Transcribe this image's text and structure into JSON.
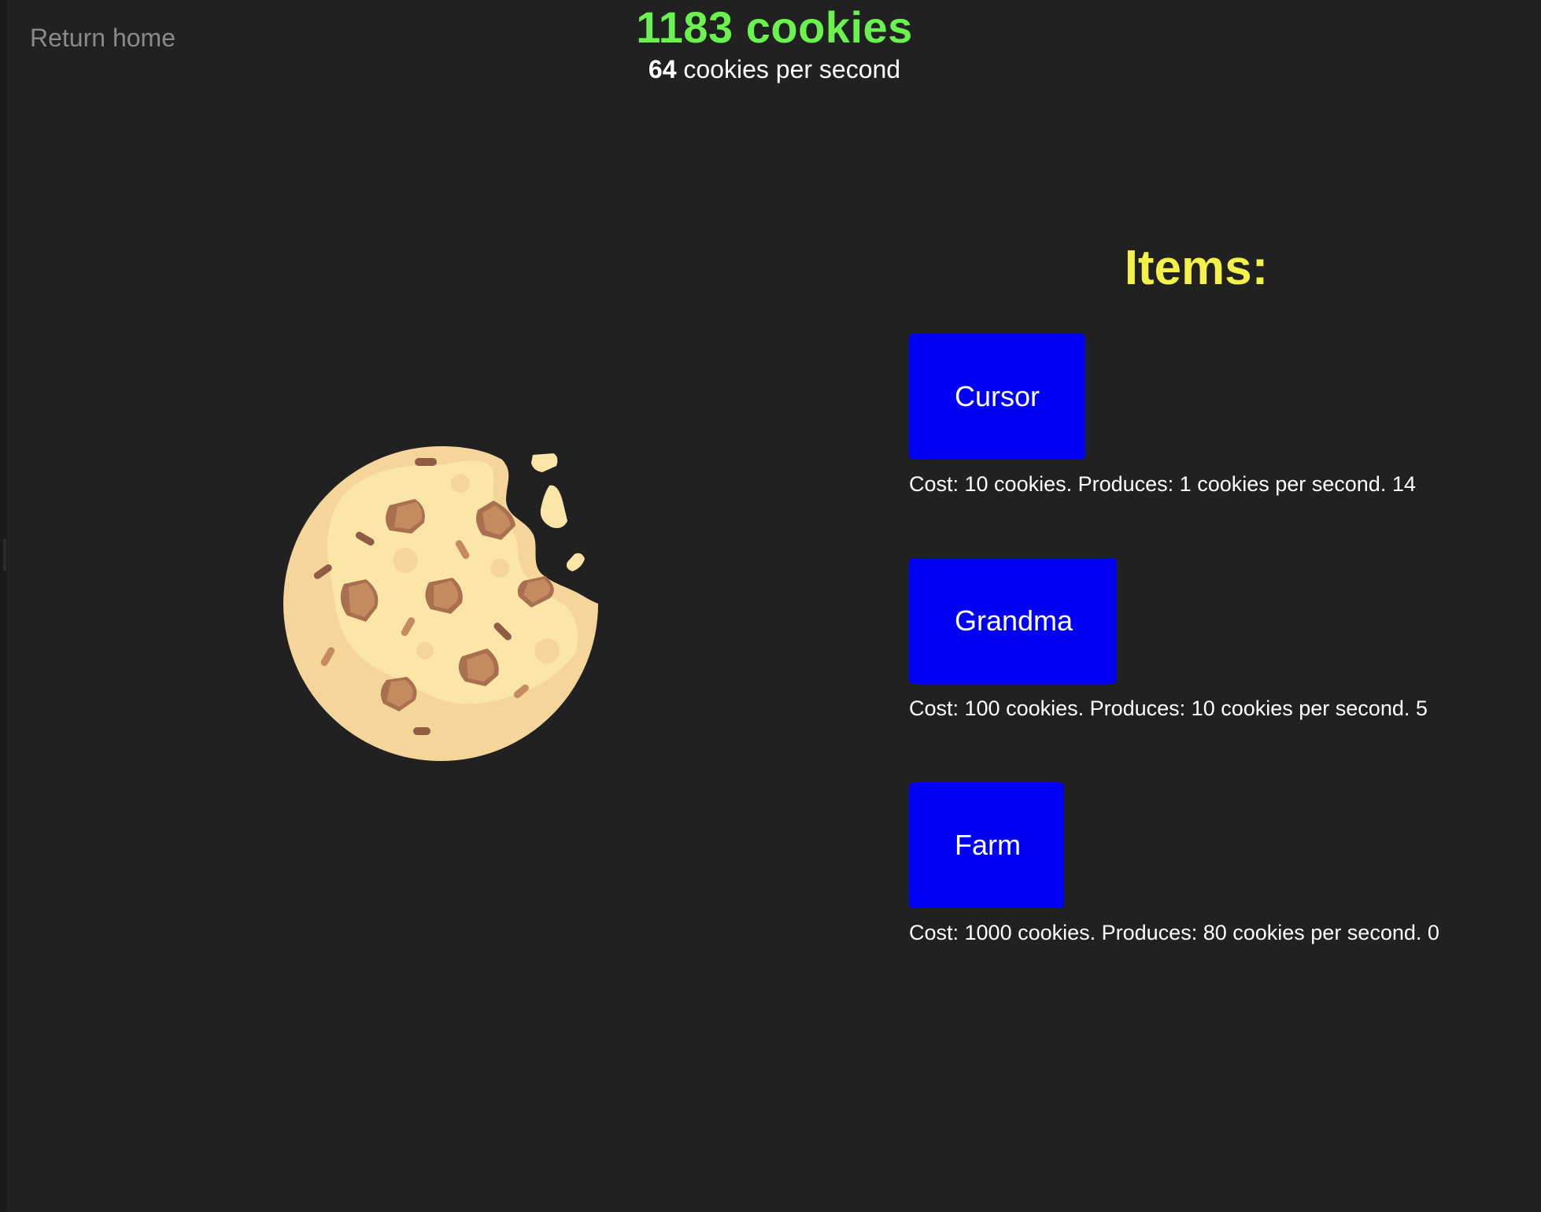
{
  "nav": {
    "return_home": "Return home"
  },
  "stats": {
    "cookies_text": "1183 cookies",
    "rate_number": "64",
    "rate_suffix": " cookies per second"
  },
  "items_title": "Items:",
  "items": [
    {
      "label": "Cursor",
      "description": "Cost: 10 cookies. Produces: 1 cookies per second. 14"
    },
    {
      "label": "Grandma",
      "description": "Cost: 100 cookies. Produces: 10 cookies per second. 5"
    },
    {
      "label": "Farm",
      "description": "Cost: 1000 cookies. Produces: 80 cookies per second. 0"
    }
  ],
  "colors": {
    "background": "#212121",
    "cookie_count": "#6cf250",
    "items_title": "#f4f24a",
    "item_button": "#0000f4",
    "return_home": "#8a8a8a"
  },
  "icons": {
    "cookie": "bitten-cookie-icon"
  }
}
